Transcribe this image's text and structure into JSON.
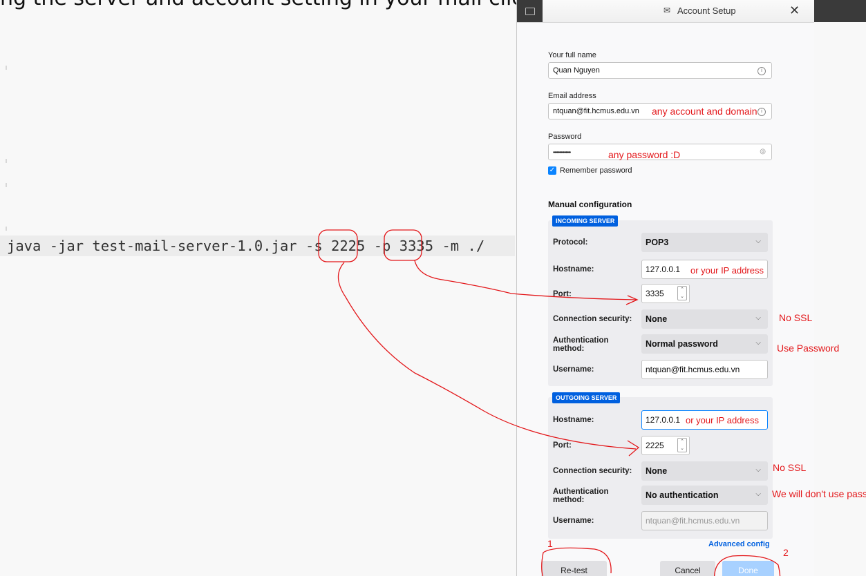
{
  "header_fragment": "ng the server and account setting in your mail client",
  "terminal": {
    "prefix": "java -jar test-mail-server-1.0.jar -s ",
    "smtp_port": "2225",
    "mid": " -p ",
    "pop_port": "3335",
    "suffix": " -m ./"
  },
  "dialog": {
    "title": "Account Setup",
    "name_label": "Your full name",
    "name_value": "Quan Nguyen",
    "email_label": "Email address",
    "email_value": "ntquan@fit.hcmus.edu.vn",
    "password_label": "Password",
    "password_value": "••••••••••••••",
    "remember_label": "Remember password",
    "manual_title": "Manual configuration",
    "incoming": {
      "badge": "INCOMING SERVER",
      "protocol_label": "Protocol:",
      "protocol_value": "POP3",
      "hostname_label": "Hostname:",
      "hostname_value": "127.0.0.1",
      "port_label": "Port:",
      "port_value": "3335",
      "security_label": "Connection security:",
      "security_value": "None",
      "auth_label_1": "Authentication",
      "auth_label_2": "method:",
      "auth_value": "Normal password",
      "username_label": "Username:",
      "username_value": "ntquan@fit.hcmus.edu.vn"
    },
    "outgoing": {
      "badge": "OUTGOING SERVER",
      "hostname_label": "Hostname:",
      "hostname_value": "127.0.0.1",
      "port_label": "Port:",
      "port_value": "2225",
      "security_label": "Connection security:",
      "security_value": "None",
      "auth_label_1": "Authentication",
      "auth_label_2": "method:",
      "auth_value": "No authentication",
      "username_label": "Username:",
      "username_value": "ntquan@fit.hcmus.edu.vn"
    },
    "advanced_link": "Advanced config",
    "retest_button": "Re-test",
    "cancel_button": "Cancel",
    "done_button": "Done"
  },
  "annotations": {
    "email_note": "any account and domain",
    "password_note": "any password :D",
    "incoming_host_note": "or your IP address",
    "incoming_security_note": "No SSL",
    "incoming_auth_note": "Use Password",
    "outgoing_host_note": "or your IP address",
    "outgoing_security_note": "No SSL",
    "outgoing_auth_note": "We will don't use pass",
    "step1": "1",
    "step2": "2"
  },
  "colors": {
    "annotation": "#e3171a",
    "accent": "#0060df"
  }
}
